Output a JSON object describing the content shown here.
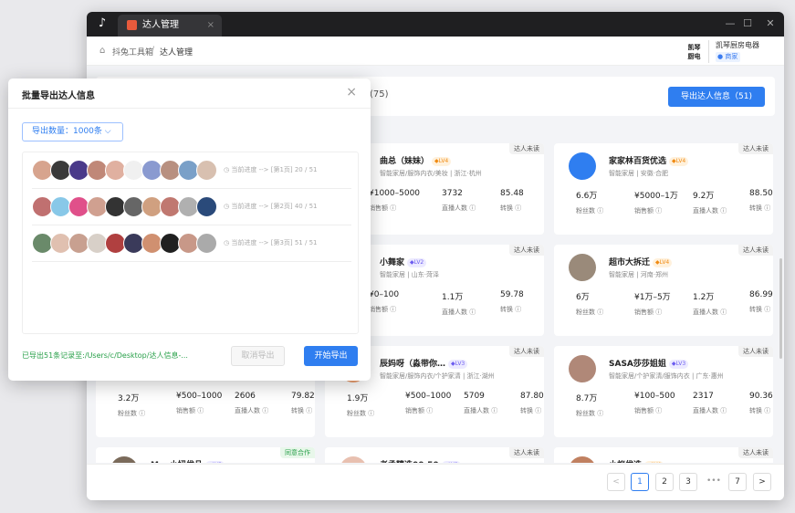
{
  "window": {
    "tab_title": "达人管理",
    "tab_close": "×",
    "minimize": "—",
    "maximize": "☐",
    "close": "✕",
    "app_logo": "♪"
  },
  "breadcrumb": {
    "home": "抖兔工具箱",
    "sep": "/",
    "current": "达人管理"
  },
  "shop": {
    "logo_text": "凯琴\n厨电",
    "name": "凯琴厨房电器",
    "tag": "商家"
  },
  "toolbar": {
    "count": "(75)",
    "export_button": "导出达人信息（51)"
  },
  "cards": [
    {
      "name": "曲总（妹妹）",
      "lv": "LV4",
      "lv_color": "orange",
      "meta": "智能家居/服饰内衣/美妆 | 浙江·杭州",
      "tag": "达人未读",
      "stats": [
        {
          "value": "¥1000–5000",
          "label": "销售额"
        },
        {
          "value": "3732",
          "label": "直播人数"
        },
        {
          "value": "85.48",
          "label": "转换"
        }
      ]
    },
    {
      "name": "家家林百货优选",
      "lv": "LV4",
      "lv_color": "orange",
      "meta": "智能家居 | 安徽·合肥",
      "tag": "达人未读",
      "stats": [
        {
          "value": "6.6万",
          "label": "粉丝数"
        },
        {
          "value": "¥5000–1万",
          "label": "销售额"
        },
        {
          "value": "9.2万",
          "label": "直播人数"
        },
        {
          "value": "88.50",
          "label": "转换"
        }
      ]
    },
    {
      "name": "小舞家",
      "lv": "LV2",
      "lv_color": "purple",
      "meta": "智能家居 | 山东·菏泽",
      "tag": "达人未读",
      "stats": [
        {
          "value": "¥0–100",
          "label": "销售额"
        },
        {
          "value": "1.1万",
          "label": "直播人数"
        },
        {
          "value": "59.78",
          "label": "转换"
        }
      ]
    },
    {
      "name": "超市大拆迁",
      "lv": "LV4",
      "lv_color": "orange",
      "meta": "智能家居 | 河南·郑州",
      "tag": "达人未读",
      "stats": [
        {
          "value": "6万",
          "label": "粉丝数"
        },
        {
          "value": "¥1万–5万",
          "label": "销售额"
        },
        {
          "value": "1.2万",
          "label": "直播人数"
        },
        {
          "value": "86.99",
          "label": "转换"
        }
      ]
    },
    {
      "name": "",
      "lv": "",
      "lv_color": "",
      "meta": "",
      "tag": "",
      "stats": [
        {
          "value": "3.2万",
          "label": "粉丝数"
        },
        {
          "value": "¥500–1000",
          "label": "销售额"
        },
        {
          "value": "2606",
          "label": "直播人数"
        },
        {
          "value": "79.82",
          "label": "转换"
        }
      ]
    },
    {
      "name": "辰妈呀（淼带你…",
      "lv": "LV3",
      "lv_color": "purple",
      "meta": "智能家居/服饰内衣/个护家清 | 浙江·湖州",
      "tag": "达人未读",
      "stats": [
        {
          "value": "1.9万",
          "label": "粉丝数"
        },
        {
          "value": "¥500–1000",
          "label": "销售额"
        },
        {
          "value": "5709",
          "label": "直播人数"
        },
        {
          "value": "87.80",
          "label": "转换"
        }
      ]
    },
    {
      "name": "SASA莎莎姐姐",
      "lv": "LV3",
      "lv_color": "purple",
      "meta": "智能家居/个护家清/服饰内衣 | 广东·惠州",
      "tag": "达人未读",
      "stats": [
        {
          "value": "8.7万",
          "label": "粉丝数"
        },
        {
          "value": "¥100–500",
          "label": "销售额"
        },
        {
          "value": "2317",
          "label": "直播人数"
        },
        {
          "value": "90.36",
          "label": "转换"
        }
      ]
    },
    {
      "name": "Max小妞优品",
      "lv": "LV2",
      "lv_color": "purple",
      "meta": "",
      "tag": "同意合作",
      "stats": []
    },
    {
      "name": "老孟精选00:50",
      "lv": "LV2",
      "lv_color": "purple",
      "meta": "",
      "tag": "达人未读",
      "stats": []
    },
    {
      "name": "小蚁优选",
      "lv": "LV4",
      "lv_color": "orange",
      "meta": "",
      "tag": "达人未读",
      "stats": []
    }
  ],
  "pagination": {
    "prev": "<",
    "pages": [
      "1",
      "2",
      "3"
    ],
    "ellipsis": "•••",
    "last": "7",
    "next": ">"
  },
  "modal": {
    "title": "批量导出达人信息",
    "close": "×",
    "quantity": "导出数量：1000条",
    "rows": [
      {
        "progress": "当前进度 --> [第1页] 20 / 51"
      },
      {
        "progress": "当前进度 --> [第2页] 40 / 51"
      },
      {
        "progress": "当前进度 --> [第3页] 51 / 51"
      }
    ],
    "export_path": "已导出51条记录至:/Users/c/Desktop/达人信息-...",
    "cancel_button": "取消导出",
    "start_button": "开始导出"
  }
}
